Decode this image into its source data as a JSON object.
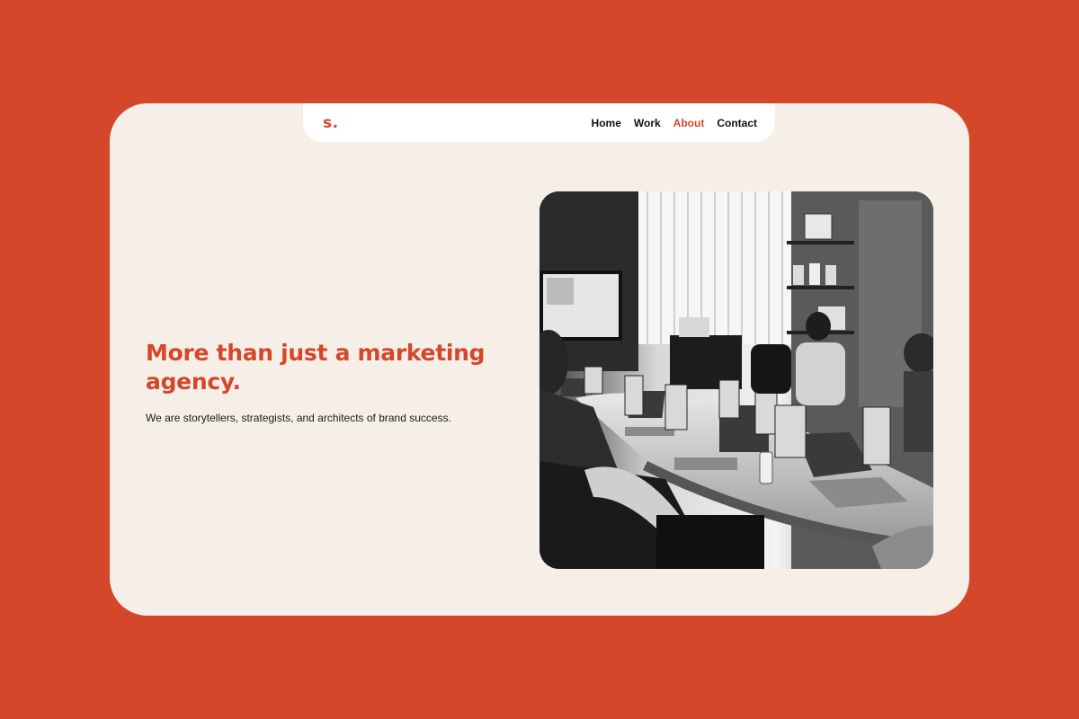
{
  "brand": {
    "logo": "s."
  },
  "nav": {
    "items": [
      {
        "label": "Home",
        "active": false
      },
      {
        "label": "Work",
        "active": false
      },
      {
        "label": "About",
        "active": true
      },
      {
        "label": "Contact",
        "active": false
      }
    ]
  },
  "hero": {
    "headline": "More than just a marketing agency.",
    "subline": "We are storytellers, strategists, and architects of brand success."
  },
  "colors": {
    "background": "#D5472B",
    "card": "#F5EFE8",
    "accent": "#D5472B",
    "nav_bg": "#FFFFFF"
  }
}
